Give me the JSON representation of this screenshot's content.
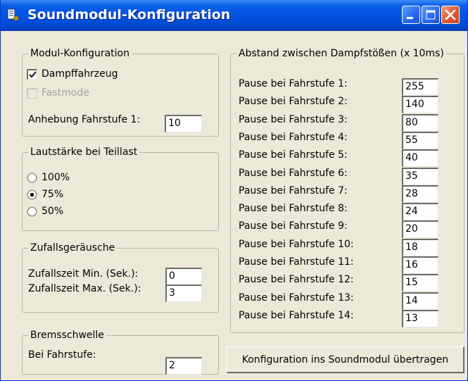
{
  "window": {
    "title": "Soundmodul-Konfiguration",
    "icon": "app-icon",
    "controls": [
      "minimize",
      "maximize",
      "close"
    ]
  },
  "modul_konfiguration": {
    "legend": "Modul-Konfiguration",
    "dampffahrzeug": {
      "label": "Dampffahrzeug",
      "checked": true
    },
    "fastmode": {
      "label": "Fastmode",
      "checked": false,
      "disabled": true
    },
    "anhebung_label": "Anhebung Fahrstufe 1:",
    "anhebung_value": "10"
  },
  "lautstaerke": {
    "legend": "Lautstärke bei Teillast",
    "options": [
      {
        "label": "100%",
        "selected": false
      },
      {
        "label": "75%",
        "selected": true
      },
      {
        "label": "50%",
        "selected": false
      }
    ]
  },
  "zufallsgeraeusche": {
    "legend": "Zufallsgeräusche",
    "min_label": "Zufallszeit Min. (Sek.):",
    "min_value": "0",
    "max_label": "Zufallszeit Max. (Sek.):",
    "max_value": "3"
  },
  "bremsschwelle": {
    "legend": "Bremsschwelle",
    "label": "Bei Fahrstufe:",
    "value": "2"
  },
  "abstand": {
    "legend": "Abstand zwischen Dampfstößen (x 10ms)",
    "rows": [
      {
        "label": "Pause bei Fahrstufe 1:",
        "value": "255"
      },
      {
        "label": "Pause bei Fahrstufe 2:",
        "value": "140"
      },
      {
        "label": "Pause bei Fahrstufe 3:",
        "value": "80"
      },
      {
        "label": "Pause bei Fahrstufe 4:",
        "value": "55"
      },
      {
        "label": "Pause bei Fahrstufe 5:",
        "value": "40"
      },
      {
        "label": "Pause bei Fahrstufe 6:",
        "value": "35"
      },
      {
        "label": "Pause bei Fahrstufe 7:",
        "value": "28"
      },
      {
        "label": "Pause bei Fahrstufe 8:",
        "value": "24"
      },
      {
        "label": "Pause bei Fahrstufe 9:",
        "value": "20"
      },
      {
        "label": "Pause bei Fahrstufe 10:",
        "value": "18"
      },
      {
        "label": "Pause bei Fahrstufe 11:",
        "value": "16"
      },
      {
        "label": "Pause bei Fahrstufe 12:",
        "value": "15"
      },
      {
        "label": "Pause bei Fahrstufe 13:",
        "value": "14"
      },
      {
        "label": "Pause bei Fahrstufe 14:",
        "value": "13"
      }
    ]
  },
  "transfer_button": {
    "label": "Konfiguration ins Soundmodul übertragen"
  }
}
